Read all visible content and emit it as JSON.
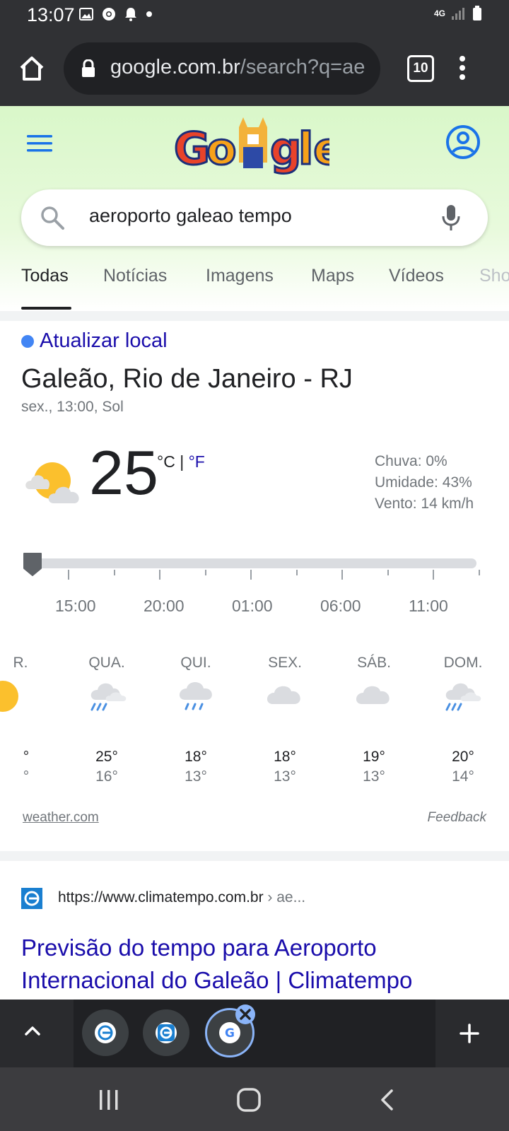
{
  "status_bar": {
    "time": "13:07",
    "network": "4G"
  },
  "browser": {
    "url_domain": "google.com.br",
    "url_path": "/search?q=ae",
    "tab_count": "10",
    "icons": [
      "home-icon",
      "lock-icon",
      "more-vert-icon"
    ]
  },
  "google": {
    "doodle_text": "Google",
    "query": "aeroporto galeao tempo",
    "tabs": [
      "Todas",
      "Notícias",
      "Imagens",
      "Maps",
      "Vídeos",
      "Sho"
    ],
    "active_tab": "Todas"
  },
  "weather": {
    "update_location": "Atualizar local",
    "location": "Galeão, Rio de Janeiro - RJ",
    "subtitle": "sex., 13:00, Sol",
    "temperature": "25",
    "unit_c": "°C",
    "unit_sep": " | ",
    "unit_f": "°F",
    "rain": "Chuva: 0%",
    "humidity": "Umidade: 43%",
    "wind": "Vento: 14 km/h",
    "hours": [
      "15:00",
      "20:00",
      "01:00",
      "06:00",
      "11:00"
    ],
    "days": [
      {
        "label": "R.",
        "high": "°",
        "low": "°",
        "icon": "sun-icon"
      },
      {
        "label": "QUA.",
        "high": "25°",
        "low": "16°",
        "icon": "rain-cloud-sun-icon"
      },
      {
        "label": "QUI.",
        "high": "18°",
        "low": "13°",
        "icon": "rain-cloud-icon"
      },
      {
        "label": "SEX.",
        "high": "18°",
        "low": "13°",
        "icon": "cloudy-icon"
      },
      {
        "label": "SÁB.",
        "high": "19°",
        "low": "13°",
        "icon": "cloudy-icon"
      },
      {
        "label": "DOM.",
        "high": "20°",
        "low": "14°",
        "icon": "rain-cloud-sun-icon"
      }
    ],
    "source": "weather.com",
    "feedback": "Feedback"
  },
  "result": {
    "url": "https://www.climatempo.com.br",
    "url_crumb": " › ae...",
    "title": "Previsão do tempo para Aeroporto Internacional do Galeão | Climatempo"
  },
  "colors": {
    "link_blue": "#1a0dab",
    "accent_blue": "#1a73e8",
    "chrome_dark": "#303134"
  }
}
